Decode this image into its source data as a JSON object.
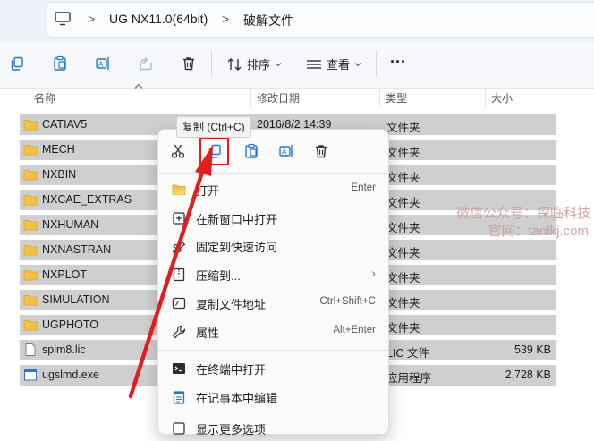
{
  "address": {
    "pc_icon": "monitor-icon",
    "crumbs": [
      "UG NX11.0(64bit)",
      "破解文件"
    ],
    "separator": ">"
  },
  "toolbar": {
    "sort_label": "排序",
    "view_label": "查看",
    "more_label": "···"
  },
  "columns": {
    "name": "名称",
    "date": "修改日期",
    "type": "类型",
    "size": "大小"
  },
  "files": [
    {
      "name": "CATIAV5",
      "date": "2016/8/2 14:39",
      "type": "文件夹",
      "size": "",
      "icon": "folder-icon"
    },
    {
      "name": "MECH",
      "date": "",
      "type": "文件夹",
      "size": "",
      "icon": "folder-icon"
    },
    {
      "name": "NXBIN",
      "date": "",
      "type": "文件夹",
      "size": "",
      "icon": "folder-icon"
    },
    {
      "name": "NXCAE_EXTRAS",
      "date": "",
      "type": "文件夹",
      "size": "",
      "icon": "folder-icon"
    },
    {
      "name": "NXHUMAN",
      "date": "",
      "type": "文件夹",
      "size": "",
      "icon": "folder-icon"
    },
    {
      "name": "NXNASTRAN",
      "date": "",
      "type": "文件夹",
      "size": "",
      "icon": "folder-icon"
    },
    {
      "name": "NXPLOT",
      "date": "",
      "type": "文件夹",
      "size": "",
      "icon": "folder-icon"
    },
    {
      "name": "SIMULATION",
      "date": "",
      "type": "文件夹",
      "size": "",
      "icon": "folder-icon"
    },
    {
      "name": "UGPHOTO",
      "date": "",
      "type": "文件夹",
      "size": "",
      "icon": "folder-icon"
    },
    {
      "name": "splm8.lic",
      "date": "",
      "type": "LIC 文件",
      "size": "539 KB",
      "icon": "file-icon"
    },
    {
      "name": "ugslmd.exe",
      "date": "",
      "type": "应用程序",
      "size": "2,728 KB",
      "icon": "exe-icon"
    }
  ],
  "tooltip": "复制 (Ctrl+C)",
  "context_menu": {
    "icon_row": [
      "cut-icon",
      "copy-icon",
      "paste-icon",
      "rename-icon",
      "delete-icon"
    ],
    "items": [
      {
        "label": "打开",
        "shortcut": "Enter",
        "icon": "folder-open-icon"
      },
      {
        "label": "在新窗口中打开",
        "shortcut": "",
        "icon": "new-window-icon"
      },
      {
        "label": "固定到快速访问",
        "shortcut": "",
        "icon": "pin-icon"
      },
      {
        "label": "压缩到...",
        "shortcut": "",
        "icon": "zip-icon",
        "submenu": true
      },
      {
        "label": "复制文件地址",
        "shortcut": "Ctrl+Shift+C",
        "icon": "copy-path-icon"
      },
      {
        "label": "属性",
        "shortcut": "Alt+Enter",
        "icon": "wrench-icon"
      },
      {
        "label": "在终端中打开",
        "shortcut": "",
        "icon": "terminal-icon"
      },
      {
        "label": "在记事本中编辑",
        "shortcut": "",
        "icon": "notepad-icon"
      },
      {
        "label": "显示更多选项",
        "shortcut": "",
        "icon": "more-options-icon"
      }
    ],
    "submenu_arrow": "›"
  },
  "watermark": {
    "line1": "微信公众号：探临科技",
    "line2": "官网：tanlkj.com"
  },
  "colors": {
    "accent": "#2b74c4",
    "selection": "#cce3f8",
    "highlight_red": "#e01e1e",
    "folder": "#f3c244"
  }
}
